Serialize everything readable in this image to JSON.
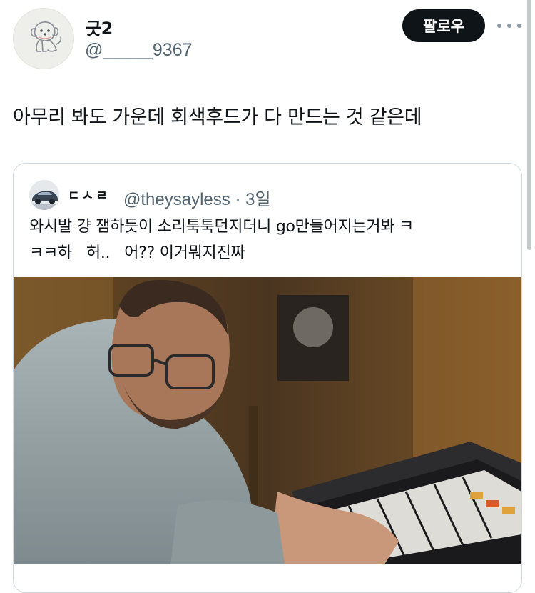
{
  "author": {
    "display_name": "긋2",
    "handle": "@_____9367"
  },
  "actions": {
    "follow_label": "팔로우",
    "more_icon": "ellipsis-icon"
  },
  "tweet": {
    "text": "아무리 봐도 가운데 회색후드가 다 만드는 것 같은데"
  },
  "quoted_tweet": {
    "display_name": "ㄷㅅㄹ",
    "handle": "@theysayless",
    "separator": "·",
    "time": "3일",
    "text_line1": "와시발 걍 잼하듯이 소리툭툭던지더니 go만들어지는거봐 ㅋ",
    "text_line2": "ㅋㅋ하   허..   어?? 이거뭐지진짜",
    "media_icon": "video-still-image"
  },
  "colors": {
    "primary_text": "#0f1419",
    "secondary_text": "#536471",
    "follow_bg": "#0f1419",
    "border": "#cfd9de"
  }
}
